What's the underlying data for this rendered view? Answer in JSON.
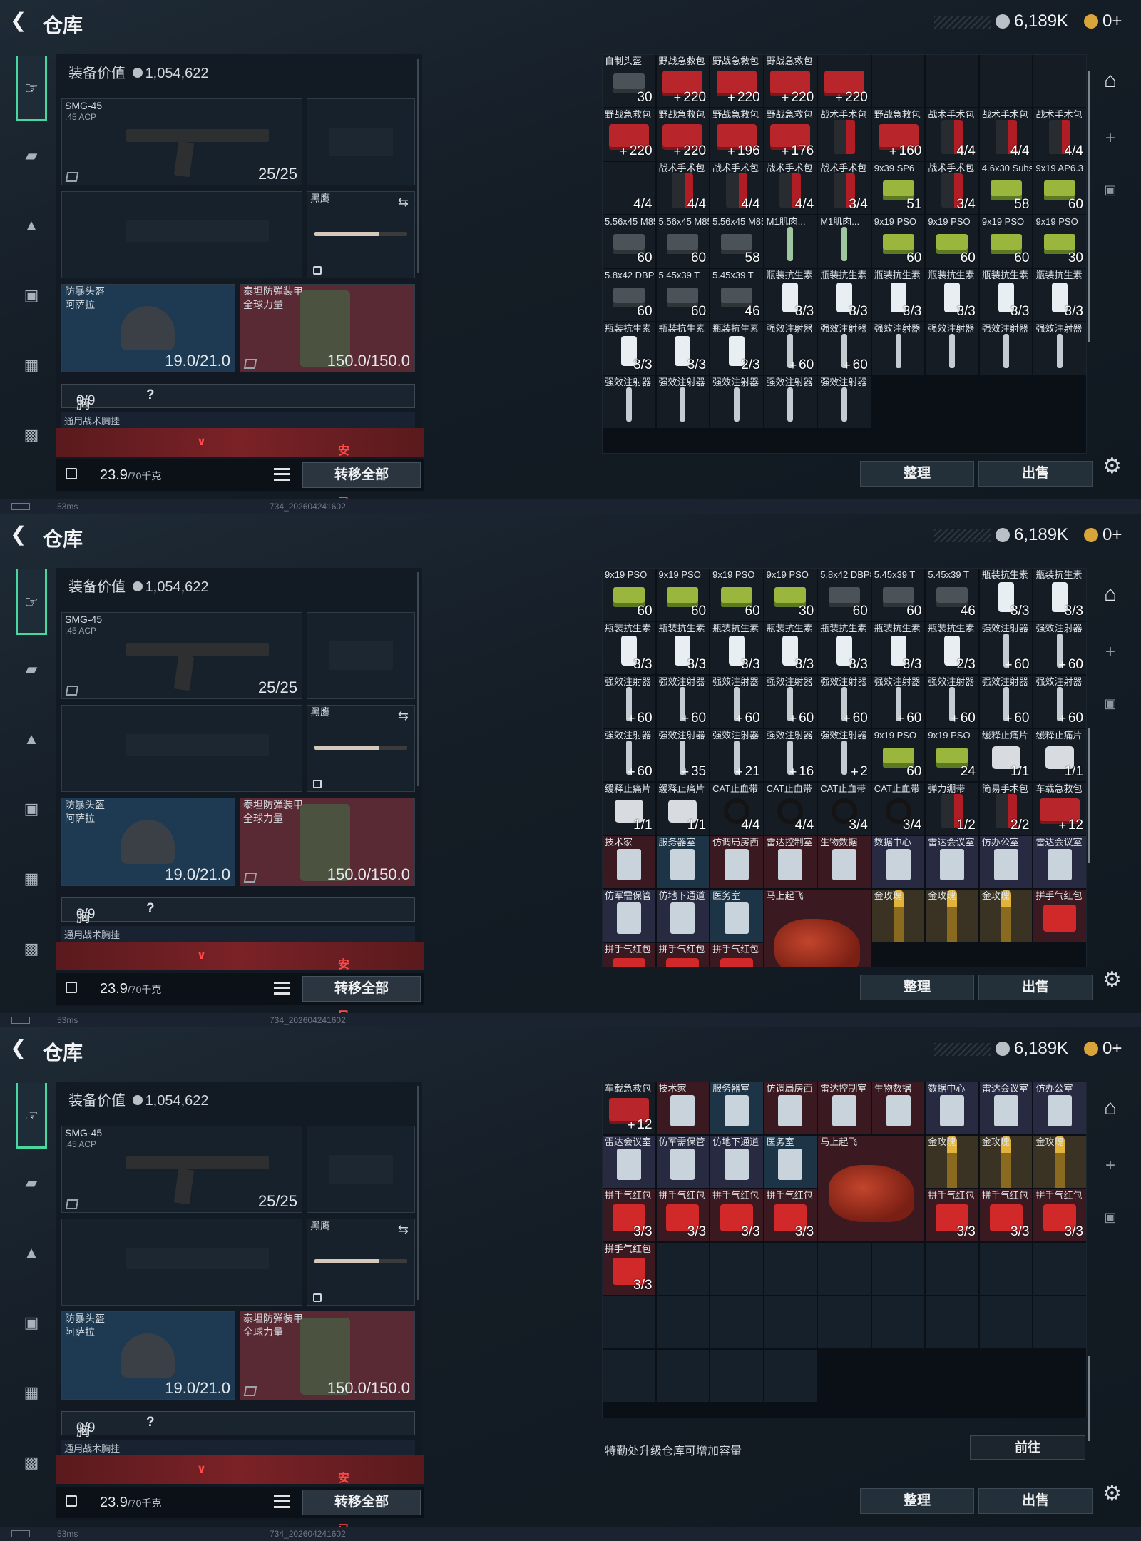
{
  "title": "仓库",
  "currency": {
    "coins": "6,189K",
    "tokens": "0+"
  },
  "equipment": {
    "value_label": "装备价值",
    "value": "1,054,622",
    "primary": {
      "name": "SMG-45",
      "ammo": ".45 ACP",
      "count": "25/25"
    },
    "melee": {
      "name": "黑鹰"
    },
    "helmet": {
      "name": "防暴头盔",
      "sub": "阿萨拉",
      "dur": "19.0/21.0"
    },
    "armor": {
      "name": "泰坦防弹装甲",
      "sub": "全球力量",
      "dur": "150.0/150.0"
    },
    "chest_label": "胸挂：",
    "chest_val": "0/9",
    "chest_help": "?",
    "rig_label": "通用战术胸挂",
    "safe_expired": "安全箱已过期",
    "weight": "23.9",
    "weight_max": "/70千克",
    "transfer_all": "转移全部"
  },
  "controls": {
    "sort": "整理",
    "sell": "出售",
    "goto": "前往",
    "upgrade_hint": "特勤处升级仓库可增加容量"
  },
  "footer": {
    "ping": "53ms",
    "build": "734_202604241602"
  },
  "panels": [
    {
      "items": [
        {
          "n": "自制头盔",
          "c": "30",
          "ic": "ammo2",
          "bg": "em"
        },
        {
          "n": "野战急救包",
          "c": "220",
          "p": 1,
          "ic": "med",
          "bg": "em"
        },
        {
          "n": "野战急救包",
          "c": "220",
          "p": 1,
          "ic": "med",
          "bg": "em"
        },
        {
          "n": "野战急救包",
          "c": "220",
          "p": 1,
          "ic": "med",
          "bg": "em"
        },
        {
          "n": "",
          "c": "220",
          "p": 1,
          "ic": "med",
          "bg": "em"
        },
        {
          "n": "",
          "c": "",
          "ic": "",
          "bg": "em"
        },
        {
          "n": "",
          "c": "",
          "ic": "",
          "bg": "em"
        },
        {
          "n": "",
          "c": "",
          "ic": "",
          "bg": "em"
        },
        {
          "n": "",
          "c": "",
          "ic": "",
          "bg": "em"
        },
        {
          "n": "野战急救包",
          "c": "220",
          "p": 1,
          "ic": "med",
          "bg": "em"
        },
        {
          "n": "野战急救包",
          "c": "220",
          "p": 1,
          "ic": "med",
          "bg": "em"
        },
        {
          "n": "野战急救包",
          "c": "196",
          "p": 1,
          "ic": "med",
          "bg": "em"
        },
        {
          "n": "野战急救包",
          "c": "176",
          "p": 1,
          "ic": "med",
          "bg": "em"
        },
        {
          "n": "战术手术包",
          "c": "",
          "ic": "tac",
          "bg": "em"
        },
        {
          "n": "野战急救包",
          "c": "160",
          "p": 1,
          "ic": "med",
          "bg": "em"
        },
        {
          "n": "战术手术包",
          "c": "4/4",
          "ic": "tac",
          "bg": "em"
        },
        {
          "n": "战术手术包",
          "c": "4/4",
          "ic": "tac",
          "bg": "em"
        },
        {
          "n": "战术手术包",
          "c": "4/4",
          "ic": "tac",
          "bg": "em"
        },
        {
          "n": "",
          "c": "4/4",
          "ic": "",
          "bg": "em"
        },
        {
          "n": "战术手术包",
          "c": "4/4",
          "ic": "tac",
          "bg": "em"
        },
        {
          "n": "战术手术包",
          "c": "4/4",
          "ic": "tac",
          "bg": "em"
        },
        {
          "n": "战术手术包",
          "c": "4/4",
          "ic": "tac",
          "bg": "em"
        },
        {
          "n": "战术手术包",
          "c": "3/4",
          "ic": "tac",
          "bg": "em"
        },
        {
          "n": "9x39 SP6",
          "c": "51",
          "ic": "ammo",
          "bg": "em"
        },
        {
          "n": "战术手术包",
          "c": "3/4",
          "ic": "tac",
          "bg": "em"
        },
        {
          "n": "4.6x30 Subsonic",
          "c": "58",
          "ic": "ammo",
          "bg": "em"
        },
        {
          "n": "9x19 AP6.3",
          "c": "60",
          "ic": "ammo",
          "bg": "em"
        },
        {
          "n": "5.56x45 M855",
          "c": "60",
          "ic": "ammo2",
          "bg": "em"
        },
        {
          "n": "5.56x45 M855",
          "c": "60",
          "ic": "ammo2",
          "bg": "em"
        },
        {
          "n": "5.56x45 M855",
          "c": "58",
          "ic": "ammo2",
          "bg": "em"
        },
        {
          "n": "M1肌肉...",
          "c": "",
          "ic": "inj2",
          "bg": "em"
        },
        {
          "n": "M1肌肉...",
          "c": "",
          "ic": "inj2",
          "bg": "em"
        },
        {
          "n": "9x19 PSO",
          "c": "60",
          "ic": "ammo",
          "bg": "em"
        },
        {
          "n": "9x19 PSO",
          "c": "60",
          "ic": "ammo",
          "bg": "em"
        },
        {
          "n": "9x19 PSO",
          "c": "60",
          "ic": "ammo",
          "bg": "em"
        },
        {
          "n": "9x19 PSO",
          "c": "30",
          "ic": "ammo",
          "bg": "em"
        },
        {
          "n": "5.8x42 DBP87",
          "c": "60",
          "ic": "ammo2",
          "bg": "em"
        },
        {
          "n": "5.45x39 T",
          "c": "60",
          "ic": "ammo2",
          "bg": "em"
        },
        {
          "n": "5.45x39 T",
          "c": "46",
          "ic": "ammo2",
          "bg": "em"
        },
        {
          "n": "瓶装抗生素",
          "c": "3/3",
          "ic": "abx",
          "bg": "em"
        },
        {
          "n": "瓶装抗生素",
          "c": "3/3",
          "ic": "abx",
          "bg": "em"
        },
        {
          "n": "瓶装抗生素",
          "c": "3/3",
          "ic": "abx",
          "bg": "em"
        },
        {
          "n": "瓶装抗生素",
          "c": "3/3",
          "ic": "abx",
          "bg": "em"
        },
        {
          "n": "瓶装抗生素",
          "c": "3/3",
          "ic": "abx",
          "bg": "em"
        },
        {
          "n": "瓶装抗生素",
          "c": "3/3",
          "ic": "abx",
          "bg": "em"
        },
        {
          "n": "瓶装抗生素",
          "c": "3/3",
          "ic": "abx",
          "bg": "em"
        },
        {
          "n": "瓶装抗生素",
          "c": "3/3",
          "ic": "abx",
          "bg": "em"
        },
        {
          "n": "瓶装抗生素",
          "c": "2/3",
          "ic": "abx",
          "bg": "em"
        },
        {
          "n": "强效注射器",
          "c": "60",
          "p": 1,
          "ic": "inj",
          "bg": "em"
        },
        {
          "n": "强效注射器",
          "c": "60",
          "p": 1,
          "ic": "inj",
          "bg": "em"
        },
        {
          "n": "强效注射器",
          "c": "",
          "ic": "inj",
          "bg": "em"
        },
        {
          "n": "强效注射器",
          "c": "",
          "ic": "inj",
          "bg": "em"
        },
        {
          "n": "强效注射器",
          "c": "",
          "ic": "inj",
          "bg": "em"
        },
        {
          "n": "强效注射器",
          "c": "",
          "ic": "inj",
          "bg": "em"
        },
        {
          "n": "强效注射器",
          "c": "",
          "ic": "inj",
          "bg": "em"
        },
        {
          "n": "强效注射器",
          "c": "",
          "ic": "inj",
          "bg": "em"
        },
        {
          "n": "强效注射器",
          "c": "",
          "ic": "inj",
          "bg": "em"
        },
        {
          "n": "强效注射器",
          "c": "",
          "ic": "inj",
          "bg": "em"
        },
        {
          "n": "强效注射器",
          "c": "",
          "ic": "inj",
          "bg": "em"
        }
      ]
    },
    {
      "items": [
        {
          "n": "9x19 PSO",
          "c": "60",
          "ic": "ammo",
          "bg": "em"
        },
        {
          "n": "9x19 PSO",
          "c": "60",
          "ic": "ammo",
          "bg": "em"
        },
        {
          "n": "9x19 PSO",
          "c": "60",
          "ic": "ammo",
          "bg": "em"
        },
        {
          "n": "9x19 PSO",
          "c": "30",
          "ic": "ammo",
          "bg": "em"
        },
        {
          "n": "5.8x42 DBP87",
          "c": "60",
          "ic": "ammo2",
          "bg": "em"
        },
        {
          "n": "5.45x39 T",
          "c": "60",
          "ic": "ammo2",
          "bg": "em"
        },
        {
          "n": "5.45x39 T",
          "c": "46",
          "ic": "ammo2",
          "bg": "em"
        },
        {
          "n": "瓶装抗生素",
          "c": "3/3",
          "ic": "abx",
          "bg": "em"
        },
        {
          "n": "瓶装抗生素",
          "c": "3/3",
          "ic": "abx",
          "bg": "em"
        },
        {
          "n": "瓶装抗生素",
          "c": "3/3",
          "ic": "abx",
          "bg": "em"
        },
        {
          "n": "瓶装抗生素",
          "c": "3/3",
          "ic": "abx",
          "bg": "em"
        },
        {
          "n": "瓶装抗生素",
          "c": "3/3",
          "ic": "abx",
          "bg": "em"
        },
        {
          "n": "瓶装抗生素",
          "c": "3/3",
          "ic": "abx",
          "bg": "em"
        },
        {
          "n": "瓶装抗生素",
          "c": "3/3",
          "ic": "abx",
          "bg": "em"
        },
        {
          "n": "瓶装抗生素",
          "c": "3/3",
          "ic": "abx",
          "bg": "em"
        },
        {
          "n": "瓶装抗生素",
          "c": "2/3",
          "ic": "abx",
          "bg": "em"
        },
        {
          "n": "强效注射器",
          "c": "60",
          "p": 1,
          "ic": "inj",
          "bg": "em"
        },
        {
          "n": "强效注射器",
          "c": "60",
          "p": 1,
          "ic": "inj",
          "bg": "em"
        },
        {
          "n": "强效注射器",
          "c": "60",
          "p": 1,
          "ic": "inj",
          "bg": "em"
        },
        {
          "n": "强效注射器",
          "c": "60",
          "p": 1,
          "ic": "inj",
          "bg": "em"
        },
        {
          "n": "强效注射器",
          "c": "60",
          "p": 1,
          "ic": "inj",
          "bg": "em"
        },
        {
          "n": "强效注射器",
          "c": "60",
          "p": 1,
          "ic": "inj",
          "bg": "em"
        },
        {
          "n": "强效注射器",
          "c": "60",
          "p": 1,
          "ic": "inj",
          "bg": "em"
        },
        {
          "n": "强效注射器",
          "c": "60",
          "p": 1,
          "ic": "inj",
          "bg": "em"
        },
        {
          "n": "强效注射器",
          "c": "60",
          "p": 1,
          "ic": "inj",
          "bg": "em"
        },
        {
          "n": "强效注射器",
          "c": "60",
          "p": 1,
          "ic": "inj",
          "bg": "em"
        },
        {
          "n": "强效注射器",
          "c": "60",
          "p": 1,
          "ic": "inj",
          "bg": "em"
        },
        {
          "n": "强效注射器",
          "c": "60",
          "p": 1,
          "ic": "inj",
          "bg": "em"
        },
        {
          "n": "强效注射器",
          "c": "35",
          "p": 1,
          "ic": "inj",
          "bg": "em"
        },
        {
          "n": "强效注射器",
          "c": "21",
          "p": 1,
          "ic": "inj",
          "bg": "em"
        },
        {
          "n": "强效注射器",
          "c": "16",
          "p": 1,
          "ic": "inj",
          "bg": "em"
        },
        {
          "n": "强效注射器",
          "c": "2",
          "p": 1,
          "ic": "inj",
          "bg": "em"
        },
        {
          "n": "9x19 PSO",
          "c": "60",
          "ic": "ammo",
          "bg": "em"
        },
        {
          "n": "9x19 PSO",
          "c": "24",
          "ic": "ammo",
          "bg": "em"
        },
        {
          "n": "缓释止痛片",
          "c": "1/1",
          "ic": "pill",
          "bg": "em"
        },
        {
          "n": "缓释止痛片",
          "c": "1/1",
          "ic": "pill",
          "bg": "em"
        },
        {
          "n": "缓释止痛片",
          "c": "1/1",
          "ic": "pill",
          "bg": "em"
        },
        {
          "n": "缓释止痛片",
          "c": "1/1",
          "ic": "pill",
          "bg": "em"
        },
        {
          "n": "CAT止血带",
          "c": "4/4",
          "ic": "cat",
          "bg": "em"
        },
        {
          "n": "CAT止血带",
          "c": "4/4",
          "ic": "cat",
          "bg": "em"
        },
        {
          "n": "CAT止血带",
          "c": "3/4",
          "ic": "cat",
          "bg": "em"
        },
        {
          "n": "CAT止血带",
          "c": "3/4",
          "ic": "cat",
          "bg": "em"
        },
        {
          "n": "弹力绷带",
          "c": "1/2",
          "ic": "tac",
          "bg": "em"
        },
        {
          "n": "简易手术包",
          "c": "2/2",
          "ic": "tac",
          "bg": "em"
        },
        {
          "n": "车载急救包",
          "c": "12",
          "p": 1,
          "ic": "med",
          "bg": "em"
        },
        {
          "n": "技术家",
          "c": "",
          "ic": "card",
          "bg": "rd"
        },
        {
          "n": "服务器室",
          "c": "",
          "ic": "card",
          "bg": "bl"
        },
        {
          "n": "仿调局房西",
          "c": "",
          "ic": "card",
          "bg": "rd"
        },
        {
          "n": "雷达控制室",
          "c": "",
          "ic": "card",
          "bg": "rd"
        },
        {
          "n": "生物数据",
          "c": "",
          "ic": "card",
          "bg": "rd"
        },
        {
          "n": "数据中心",
          "c": "",
          "ic": "card",
          "bg": "pr"
        },
        {
          "n": "雷达会议室",
          "c": "",
          "ic": "card",
          "bg": "pr"
        },
        {
          "n": "仿办公室",
          "c": "",
          "ic": "card",
          "bg": "pr"
        },
        {
          "n": "雷达会议室",
          "c": "",
          "ic": "card",
          "bg": "pr"
        },
        {
          "n": "仿军需保管",
          "c": "",
          "ic": "card",
          "bg": "pr"
        },
        {
          "n": "仿地下通道",
          "c": "",
          "ic": "card",
          "bg": "pr"
        },
        {
          "n": "医务室",
          "c": "",
          "ic": "card",
          "bg": "bl"
        },
        {
          "n": "马上起飞",
          "c": "",
          "ic": "horse",
          "bg": "rd",
          "span": 2
        },
        {
          "n": "金玫瑰",
          "c": "",
          "ic": "rose",
          "bg": "gd"
        },
        {
          "n": "金玫瑰",
          "c": "",
          "ic": "rose",
          "bg": "gd"
        },
        {
          "n": "金玫瑰",
          "c": "",
          "ic": "rose",
          "bg": "gd"
        },
        {
          "n": "拼手气红包",
          "c": "",
          "ic": "red",
          "bg": "rd"
        },
        {
          "n": "拼手气红包",
          "c": "",
          "ic": "red",
          "bg": "rd"
        },
        {
          "n": "拼手气红包",
          "c": "",
          "ic": "red",
          "bg": "rd"
        },
        {
          "n": "拼手气红包",
          "c": "",
          "ic": "red",
          "bg": "rd"
        }
      ]
    },
    {
      "items": [
        {
          "n": "车载急救包",
          "c": "12",
          "p": 1,
          "ic": "med",
          "bg": "em"
        },
        {
          "n": "技术家",
          "c": "",
          "ic": "card",
          "bg": "rd"
        },
        {
          "n": "服务器室",
          "c": "",
          "ic": "card",
          "bg": "bl"
        },
        {
          "n": "仿调局房西",
          "c": "",
          "ic": "card",
          "bg": "rd"
        },
        {
          "n": "雷达控制室",
          "c": "",
          "ic": "card",
          "bg": "rd"
        },
        {
          "n": "生物数据",
          "c": "",
          "ic": "card",
          "bg": "rd"
        },
        {
          "n": "数据中心",
          "c": "",
          "ic": "card",
          "bg": "pr"
        },
        {
          "n": "雷达会议室",
          "c": "",
          "ic": "card",
          "bg": "pr"
        },
        {
          "n": "仿办公室",
          "c": "",
          "ic": "card",
          "bg": "pr"
        },
        {
          "n": "雷达会议室",
          "c": "",
          "ic": "card",
          "bg": "pr"
        },
        {
          "n": "仿军需保管",
          "c": "",
          "ic": "card",
          "bg": "pr"
        },
        {
          "n": "仿地下通道",
          "c": "",
          "ic": "card",
          "bg": "pr"
        },
        {
          "n": "医务室",
          "c": "",
          "ic": "card",
          "bg": "bl"
        },
        {
          "n": "马上起飞",
          "c": "",
          "ic": "horse",
          "bg": "rd",
          "span": 2
        },
        {
          "n": "金玫瑰",
          "c": "",
          "ic": "rose",
          "bg": "gd"
        },
        {
          "n": "金玫瑰",
          "c": "",
          "ic": "rose",
          "bg": "gd"
        },
        {
          "n": "金玫瑰",
          "c": "",
          "ic": "rose",
          "bg": "gd"
        },
        {
          "n": "拼手气红包",
          "c": "3/3",
          "ic": "red",
          "bg": "rd"
        },
        {
          "n": "拼手气红包",
          "c": "3/3",
          "ic": "red",
          "bg": "rd"
        },
        {
          "n": "拼手气红包",
          "c": "3/3",
          "ic": "red",
          "bg": "rd"
        },
        {
          "n": "拼手气红包",
          "c": "3/3",
          "ic": "red",
          "bg": "rd"
        },
        {
          "n": "拼手气红包",
          "c": "3/3",
          "ic": "red",
          "bg": "rd"
        },
        {
          "n": "拼手气红包",
          "c": "3/3",
          "ic": "red",
          "bg": "rd"
        },
        {
          "n": "拼手气红包",
          "c": "3/3",
          "ic": "red",
          "bg": "rd"
        },
        {
          "n": "拼手气红包",
          "c": "3/3",
          "ic": "red",
          "bg": "rd"
        }
      ]
    }
  ]
}
